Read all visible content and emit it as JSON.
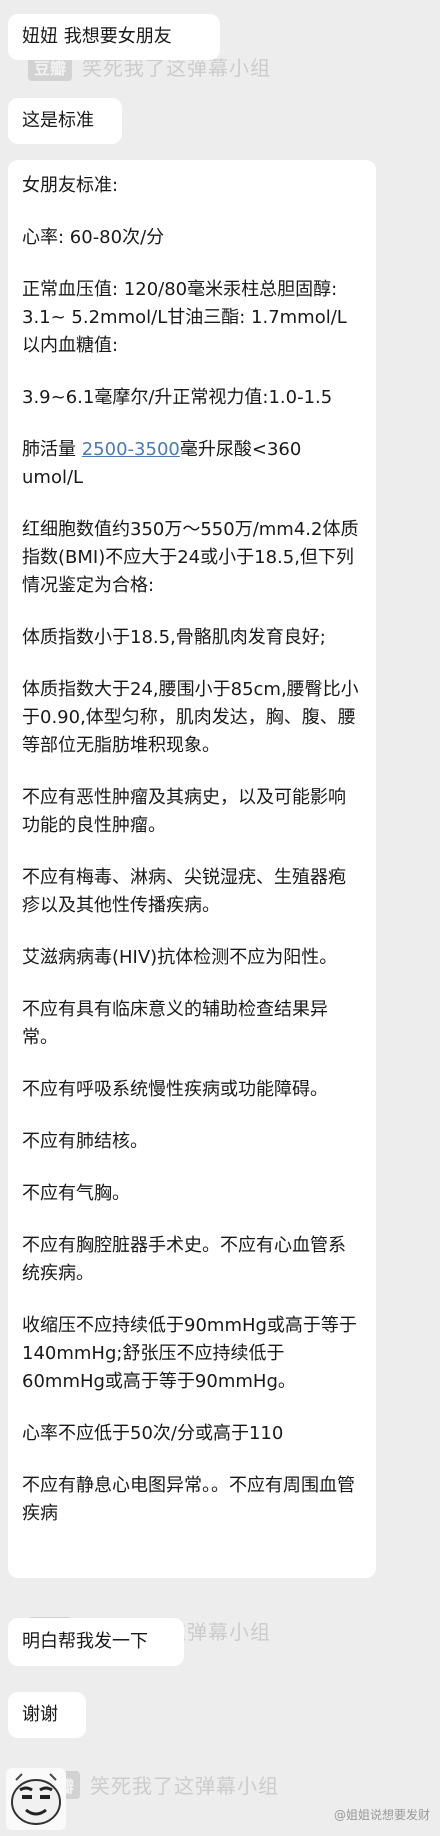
{
  "messages": {
    "m1": "妞妞 我想要女朋友",
    "m2": "这是标准",
    "m3": {
      "p1": "女朋友标准:",
      "p2": "心率: 60-80次/分",
      "p3": "正常血压值: 120/80毫米汞柱总胆固醇: 3.1~ 5.2mmol/L甘油三酯: 1.7mmol/L以内血糖值:",
      "p4": "3.9~6.1毫摩尔/升正常视力值:1.0-1.5",
      "p5_pre": "肺活量 ",
      "p5_link": "2500-3500",
      "p5_post": "毫升尿酸<360 umol/L",
      "p6": "红细胞数值约350万～550万/mm4.2体质指数(BMI)不应大于24或小于18.5,但下列情况鉴定为合格:",
      "p7": "体质指数小于18.5,骨骼肌肉发育良好;",
      "p8": "体质指数大于24,腰围小于85cm,腰臀比小于0.90,体型匀称，肌肉发达，胸、腹、腰等部位无脂肪堆积现象。",
      "p9": "不应有恶性肿瘤及其病史，以及可能影响功能的良性肿瘤。",
      "p10": "不应有梅毒、淋病、尖锐湿疣、生殖器疱疹以及其他性传播疾病。",
      "p11": "艾滋病病毒(HIV)抗体检测不应为阳性。",
      "p12": "不应有具有临床意义的辅助检查结果异常。",
      "p13": "不应有呼吸系统慢性疾病或功能障碍。",
      "p14": "不应有肺结核。",
      "p15": "不应有气胸。",
      "p16": "不应有胸腔脏器手术史。不应有心血管系统疾病。",
      "p17": "收缩压不应持续低于90mmHg或高于等于140mmHg;舒张压不应持续低于60mmHg或高于等于90mmHg。",
      "p18": "心率不应低于50次/分或高于110",
      "p19": "不应有静息心电图异常。。不应有周围血管疾病"
    },
    "m4": "明白帮我发一下",
    "m5": "谢谢"
  },
  "watermark": {
    "logo": "豆瓣",
    "text": "笑死我了这弹幕小组"
  },
  "credit": "@姐姐说想要发财",
  "colors": {
    "background": "#ededed",
    "bubble": "#ffffff",
    "link": "#4a7bb8"
  }
}
